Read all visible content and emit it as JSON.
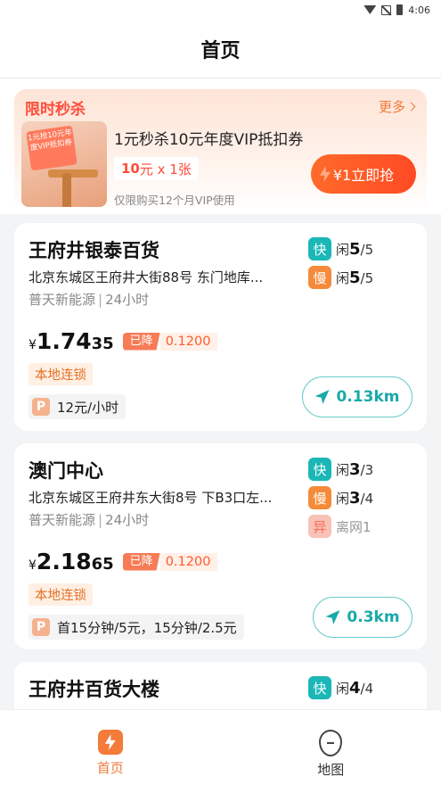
{
  "status": {
    "time": "4:06"
  },
  "header": {
    "title": "首页"
  },
  "promo": {
    "title": "限时秒杀",
    "more_label": "更多",
    "coupon_image_text": "1元抢10元年度VIP抵扣券",
    "name": "1元秒杀10元年度VIP抵扣券",
    "price_a": "10",
    "price_b": "元 x 1张",
    "note": "仅限购买12个月VIP使用",
    "button_label": "¥1立即抢"
  },
  "stations": [
    {
      "name": "王府井银泰百货",
      "address": "北京东城区王府井大街88号 东门地库...",
      "operator": "普天新能源",
      "hours": "24小时",
      "ports": [
        {
          "type": "快",
          "status": "闲",
          "free": "5",
          "total": "/5"
        },
        {
          "type": "慢",
          "status": "闲",
          "free": "5",
          "total": "/5"
        }
      ],
      "currency": "¥",
      "price_big": "1.74",
      "price_small": "35",
      "drop_label": "已降",
      "drop_value": "0.1200",
      "chain": "本地连锁",
      "parking_icon": "P",
      "parking": "12元/小时",
      "distance": "0.13km"
    },
    {
      "name": "澳门中心",
      "address": "北京东城区王府井东大街8号 下B3口左...",
      "operator": "普天新能源",
      "hours": "24小时",
      "ports": [
        {
          "type": "快",
          "status": "闲",
          "free": "3",
          "total": "/3"
        },
        {
          "type": "慢",
          "status": "闲",
          "free": "3",
          "total": "/4"
        },
        {
          "type": "异",
          "status": "离网1"
        }
      ],
      "currency": "¥",
      "price_big": "2.18",
      "price_small": "65",
      "drop_label": "已降",
      "drop_value": "0.1200",
      "chain": "本地连锁",
      "parking_icon": "P",
      "parking": "首15分钟/5元，15分钟/2.5元",
      "distance": "0.3km"
    },
    {
      "name": "王府井百货大楼",
      "ports": [
        {
          "type": "快",
          "status": "闲",
          "free": "4",
          "total": "/4"
        }
      ]
    }
  ],
  "tabs": [
    {
      "label": "首页",
      "icon": "charge-icon",
      "active": true
    },
    {
      "label": "地图",
      "icon": "map-pin-icon",
      "active": false
    }
  ],
  "colors": {
    "accent": "#f47b3a",
    "teal": "#1aa9a9",
    "red": "#ff4d3a"
  }
}
